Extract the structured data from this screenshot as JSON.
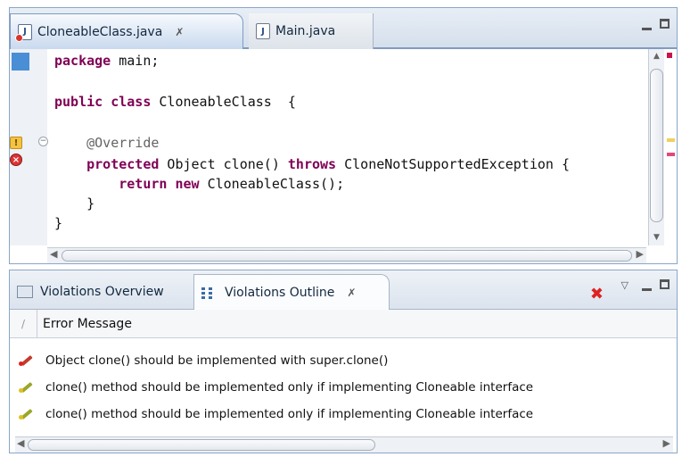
{
  "editor": {
    "tabs": [
      {
        "label": "CloneableClass.java",
        "close": "✗",
        "active": true
      },
      {
        "label": "Main.java",
        "active": false
      }
    ],
    "file_icon_letter": "J",
    "code_lines": [
      {
        "parts": [
          [
            "kw",
            "package"
          ],
          [
            "t",
            " main;"
          ]
        ]
      },
      {
        "parts": [
          [
            "kw",
            "public class"
          ],
          [
            "t",
            " CloneableClass  {"
          ]
        ]
      },
      {
        "parts": [
          [
            "ann",
            "    @Override"
          ]
        ]
      },
      {
        "parts": [
          [
            "kw",
            "    protected"
          ],
          [
            "t",
            " Object clone() "
          ],
          [
            "kw",
            "throws"
          ],
          [
            "t",
            " CloneNotSupportedException {"
          ]
        ]
      },
      {
        "parts": [
          [
            "kw",
            "        return new"
          ],
          [
            "t",
            " CloneableClass();"
          ]
        ]
      },
      {
        "parts": [
          [
            "t",
            "    }"
          ]
        ]
      },
      {
        "parts": [
          [
            "t",
            "}"
          ]
        ]
      }
    ],
    "markers": {
      "warning": "!",
      "error": "×"
    },
    "fold_symbol": "−"
  },
  "violations": {
    "tabs": [
      {
        "label": "Violations Overview",
        "active": false
      },
      {
        "label": "Violations Outline",
        "active": true,
        "close": "✗"
      }
    ],
    "column_header": "Error Message",
    "rows": [
      {
        "message": "Object clone() should be implemented with super.clone()",
        "severity": "error"
      },
      {
        "message": "clone() method should be implemented only if implementing Cloneable interface",
        "severity": "warning"
      },
      {
        "message": "clone() method should be implemented only if implementing Cloneable interface",
        "severity": "warning"
      }
    ],
    "toolbar": {
      "delete": "✖",
      "view_menu": "▽"
    }
  },
  "colors": {
    "keyword": "#7f0055",
    "annotation": "#646464",
    "error": "#d22222",
    "warning": "#e0c020",
    "tab_border": "#7f9bc1"
  }
}
